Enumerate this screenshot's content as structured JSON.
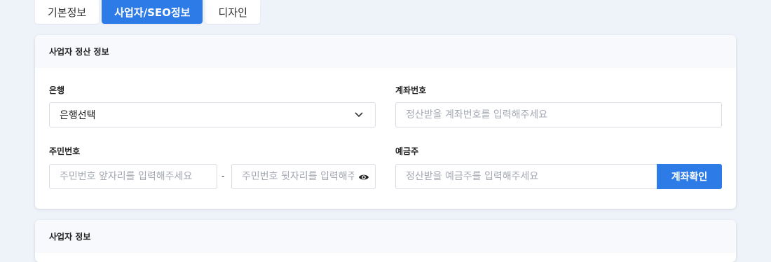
{
  "tabs": [
    {
      "label": "기본정보",
      "active": false
    },
    {
      "label": "사업자/SEO정보",
      "active": true
    },
    {
      "label": "디자인",
      "active": false
    }
  ],
  "settlement": {
    "title": "사업자 정산 정보",
    "bank": {
      "label": "은행",
      "value": "은행선택"
    },
    "account": {
      "label": "계좌번호",
      "placeholder": "정산받을 계좌번호를 입력해주세요"
    },
    "resident": {
      "label": "주민번호",
      "front_placeholder": "주민번호 앞자리를 입력해주세요",
      "separator": "-",
      "back_placeholder": "주민번호 뒷자리를 입력해주세요"
    },
    "holder": {
      "label": "예금주",
      "placeholder": "정산받을 예금주를 입력해주세요",
      "verify_button": "계좌확인"
    }
  },
  "business": {
    "title": "사업자 정보"
  },
  "colors": {
    "accent": "#2d7be6",
    "background": "#eef2f9"
  },
  "icons": {
    "bank_dropdown": "chevron-down-icon",
    "resident_toggle": "eye-icon"
  }
}
